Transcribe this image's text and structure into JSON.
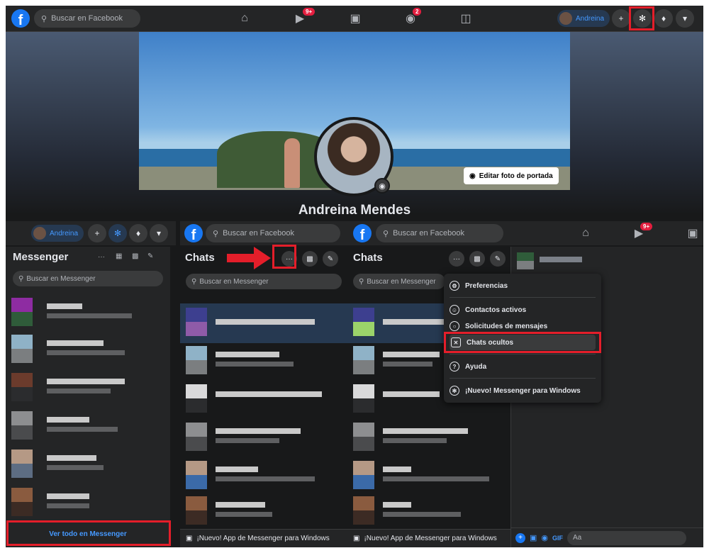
{
  "topbar": {
    "search_placeholder": "Buscar en Facebook",
    "badge_watch": "9+",
    "badge_groups": "2",
    "profile_name": "Andreina",
    "add_label": "+"
  },
  "profile": {
    "name": "Andreina Mendes",
    "edit_cover": "Editar foto de portada"
  },
  "left_panel": {
    "pill_name": "Andreina",
    "title": "Messenger",
    "search_placeholder": "Buscar en Messenger",
    "footer_link": "Ver todo en Messenger"
  },
  "mid_panel": {
    "search_placeholder": "Buscar en Facebook",
    "title": "Chats",
    "messenger_search": "Buscar en Messenger",
    "more_label": "···",
    "footer": "¡Nuevo! App de Messenger para Windows"
  },
  "right_panel": {
    "search_placeholder": "Buscar en Facebook",
    "title": "Chats",
    "messenger_search": "Buscar en Messenger",
    "more_label": "···",
    "footer": "¡Nuevo! App de Messenger para Windows",
    "badge_watch": "9+",
    "composer_placeholder": "Aa"
  },
  "menu": {
    "items": [
      {
        "label": "Preferencias",
        "icon": "gear-icon"
      },
      {
        "label": "Contactos activos",
        "icon": "person-icon"
      },
      {
        "label": "Solicitudes de mensajes",
        "icon": "chat-bubble-icon"
      },
      {
        "label": "Chats ocultos",
        "icon": "hidden-box-icon"
      },
      {
        "label": "Ayuda",
        "icon": "help-icon"
      },
      {
        "label": "¡Nuevo! Messenger para Windows",
        "icon": "messenger-icon"
      }
    ]
  },
  "colors": {
    "accent": "#1877f2",
    "highlight": "#e41e2a",
    "background": "#18191a",
    "surface": "#242526"
  }
}
